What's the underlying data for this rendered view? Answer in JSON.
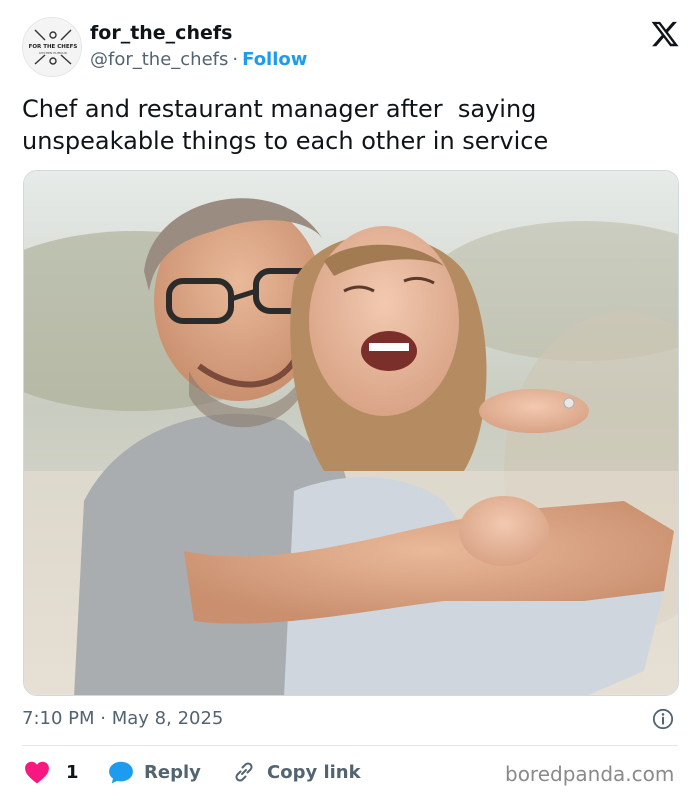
{
  "author": {
    "display_name": "for_the_chefs",
    "handle": "@for_the_chefs",
    "separator": "·",
    "follow_label": "Follow",
    "avatar_text": "FOR THE CHEFS",
    "avatar_subtext": "KITCHEN HUMOUR"
  },
  "tweet": {
    "text": "Chef and restaurant manager after  saying\nunspeakable things to each other in service",
    "time": "7:10 PM",
    "date_separator": "·",
    "date": "May 8, 2025"
  },
  "actions": {
    "like_count": "1",
    "reply_label": "Reply",
    "copy_label": "Copy link"
  },
  "watermark": "boredpanda.com",
  "colors": {
    "accent": "#1d9bf0",
    "like": "#f91880",
    "secondary_text": "#536471"
  },
  "icons": [
    "x-logo-icon",
    "info-icon",
    "heart-icon",
    "reply-bubble-icon",
    "link-icon"
  ]
}
